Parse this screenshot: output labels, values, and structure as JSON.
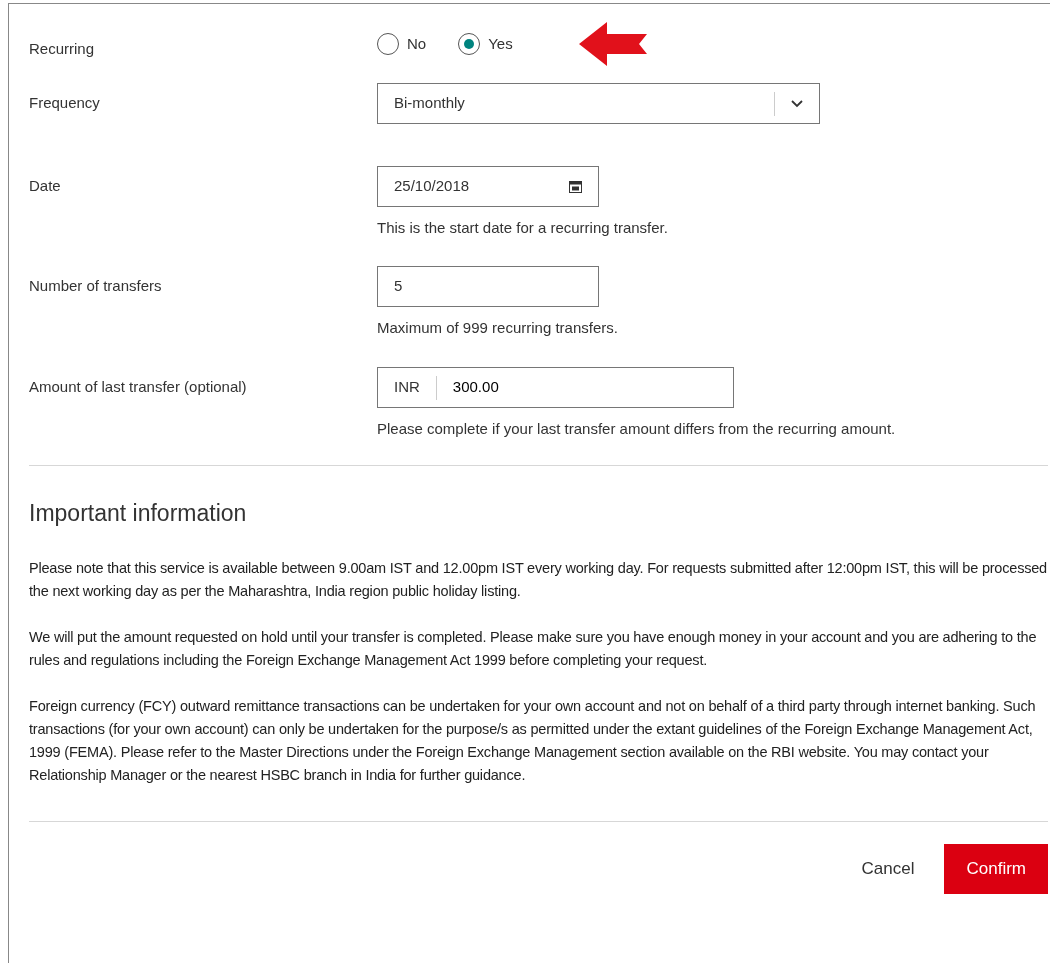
{
  "fields": [
    {
      "kind": "radio",
      "label": "Recurring",
      "options": [
        {
          "label": "No",
          "selected": false
        },
        {
          "label": "Yes",
          "selected": true
        }
      ]
    },
    {
      "kind": "select",
      "label": "Frequency",
      "value": "Bi-monthly"
    },
    {
      "kind": "date",
      "label": "Date",
      "value": "25/10/2018",
      "help": "This is the start date for a recurring transfer."
    },
    {
      "kind": "text",
      "label": "Number of transfers",
      "value": "5",
      "help": "Maximum of 999 recurring transfers."
    },
    {
      "kind": "currency",
      "label": "Amount of last transfer (optional)",
      "currency": "INR",
      "value": "300.00",
      "help": "Please complete if your last transfer amount differs from the recurring amount."
    }
  ],
  "important_information": {
    "title": "Important information",
    "paragraphs": [
      "Please note that this service is available between 9.00am IST and 12.00pm IST every working day. For requests submitted after 12:00pm IST, this will be processed the next working day as per the Maharashtra, India region public holiday listing.",
      "We will put the amount requested on hold until your transfer is completed. Please make sure you have enough money in your account and you are adhering to the rules and regulations including the Foreign Exchange Management Act 1999 before completing your request.",
      "Foreign currency (FCY) outward remittance transactions can be undertaken for your own account and not on behalf of a third party through internet banking. Such transactions (for your own account) can only be undertaken for the purpose/s as permitted under the extant guidelines of the Foreign Exchange Management Act, 1999 (FEMA). Please refer to the Master Directions under the Foreign Exchange Management section available on the RBI website. You may contact your Relationship Manager or the nearest HSBC branch in India for further guidance."
    ]
  },
  "buttons": [
    {
      "kind": "secondary",
      "label": "Cancel"
    },
    {
      "kind": "primary",
      "label": "Confirm"
    }
  ]
}
